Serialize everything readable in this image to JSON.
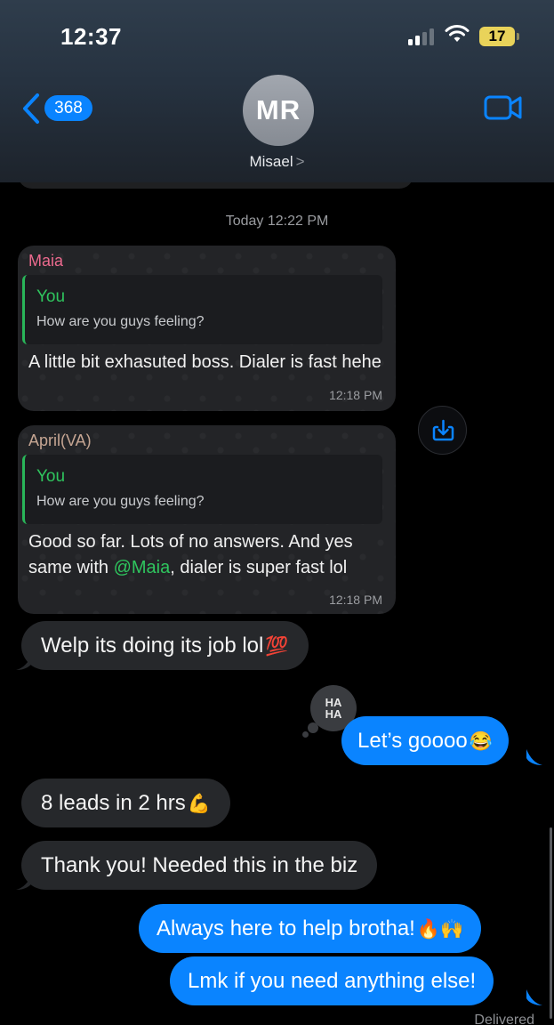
{
  "status_bar": {
    "time": "12:37",
    "battery": "17",
    "battery_color": "#e9d35a"
  },
  "header": {
    "back_count": "368",
    "avatar_initials": "MR",
    "contact_name": "Misael",
    "contact_chevron": ">",
    "accent": "#0a84ff"
  },
  "chat": {
    "timestamp": "Today 12:22 PM",
    "quote1": {
      "sender": "Maia",
      "reply_author": "You",
      "reply_text": "How are you guys feeling?",
      "message": "A little bit exhasuted boss. Dialer is fast hehe",
      "time": "12:18 PM"
    },
    "quote2": {
      "sender": "April(VA)",
      "reply_author": "You",
      "reply_text": "How are you guys feeling?",
      "message_before": "Good so far. Lots of no answers. And yes same with ",
      "mention": "@Maia",
      "message_after": ", dialer is super fast lol",
      "time": "12:18 PM"
    },
    "messages": [
      {
        "direction": "in",
        "text": "Welp its doing its job lol",
        "emoji": "💯"
      },
      {
        "direction": "out",
        "text": "Let’s goooo",
        "emoji": "😂",
        "reaction": "HA HA"
      },
      {
        "direction": "in",
        "text": "8 leads in 2 hrs",
        "emoji": "💪"
      },
      {
        "direction": "in",
        "text": "Thank you! Needed this in the biz",
        "emoji": ""
      },
      {
        "direction": "out",
        "text": "Always here to help brotha!",
        "emoji": "🔥🙌"
      },
      {
        "direction": "out",
        "text": "Lmk if you need anything else!",
        "emoji": ""
      }
    ],
    "status": "Delivered",
    "reaction_top": "HA",
    "reaction_bottom": "HA"
  },
  "icons": {
    "back": "chevron-left-icon",
    "video": "video-camera-icon",
    "download": "download-icon",
    "signal": "cellular-signal-icon",
    "wifi": "wifi-icon",
    "battery": "battery-icon"
  }
}
